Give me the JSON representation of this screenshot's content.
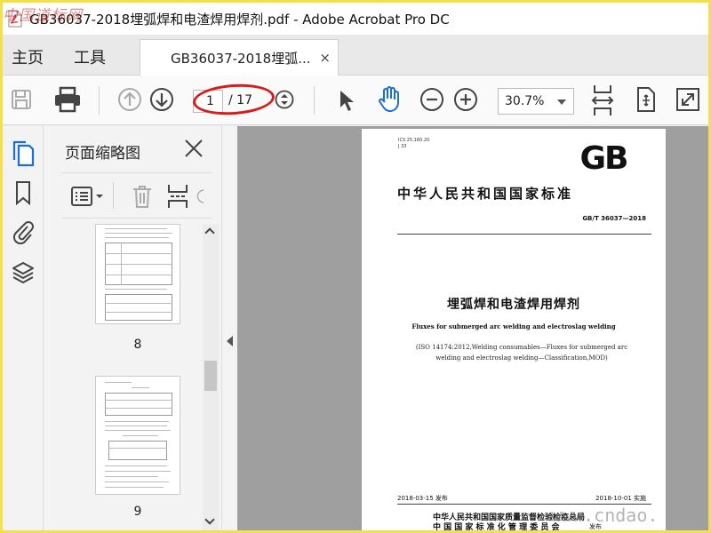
{
  "watermark_top": "中国道标网",
  "watermark_bottom": "www.cndao.",
  "window": {
    "title": "GB36037-2018埋弧焊和电渣焊用焊剂.pdf - Adobe Acrobat Pro DC"
  },
  "menu": {
    "home": "主页",
    "tools": "工具"
  },
  "tab": {
    "label": "GB36037-2018埋弧...",
    "close": "×"
  },
  "toolbar": {
    "current_page": "1",
    "total_pages": "/ 17",
    "zoom": "30.7%",
    "icons": [
      "save-icon",
      "print-icon",
      "prev-page-icon",
      "next-page-icon",
      "page-stepper-icon",
      "select-arrow-icon",
      "hand-tool-icon",
      "zoom-out-icon",
      "zoom-in-icon",
      "fit-width-icon",
      "rotate-fit-icon",
      "full-screen-icon"
    ]
  },
  "rail": {
    "icons": [
      "page-thumbnails-icon",
      "bookmarks-icon",
      "attachments-icon",
      "layers-icon"
    ]
  },
  "panel": {
    "title": "页面缩略图",
    "close": "×",
    "thumbnails": [
      {
        "page": "8"
      },
      {
        "page": "9"
      }
    ]
  },
  "document": {
    "ics": "ICS 25.160.20",
    "ccs": "J 33",
    "logo": "GB",
    "national_standard": "中华人民共和国国家标准",
    "std_number": "GB/T 36037—2018",
    "title_cn": "埋弧焊和电渣焊用焊剂",
    "title_en": "Fluxes for submerged arc welding and electroslag welding",
    "iso_line1": "(ISO 14174:2012,Welding consumables—Fluxes for submerged arc",
    "iso_line2": "welding and electroslag welding—Classification,MOD)",
    "issue_date": "2018-03-15 发布",
    "impl_date": "2018-10-01 实施",
    "issuer1": "中华人民共和国国家质量监督检验检疫总局",
    "issuer2": "中 国 国 家 标 准 化 管 理 委 员 会",
    "fabu": "发布"
  },
  "colors": {
    "accent_blue": "#1a6fd4",
    "annotation_red": "#d81c1c",
    "doc_bg": "#9f9f9f"
  }
}
